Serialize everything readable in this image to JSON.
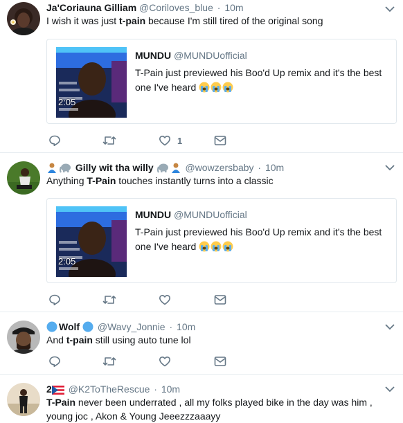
{
  "tweets": [
    {
      "name": "Ja'Coriauna Gilliam",
      "handle": "@Coriloves_blue",
      "separator": "·",
      "time": "10m",
      "text_before": "I wish it was just ",
      "text_bold": "t-pain",
      "text_after": " because I'm still tired of the original song",
      "quote": {
        "name": "MUNDU",
        "handle": "@MUNDUofficial",
        "text": "T-Pain just previewed his Boo'd Up remix and it's the best one I've heard",
        "video_time": "2:05"
      },
      "like_count": "1"
    },
    {
      "name": "Gilly wit tha willy",
      "handle": "@wowzersbaby",
      "separator": "·",
      "time": "10m",
      "text_before": "Anything ",
      "text_bold": "T-Pain",
      "text_after": " touches instantly turns into a classic",
      "quote": {
        "name": "MUNDU",
        "handle": "@MUNDUofficial",
        "text": "T-Pain just previewed his Boo'd Up remix and it's the best one I've heard",
        "video_time": "2:05"
      }
    },
    {
      "name": "Wolf",
      "handle": "@Wavy_Jonnie",
      "separator": "·",
      "time": "10m",
      "text_before": "And ",
      "text_bold": "t-pain",
      "text_after": " still using auto tune lol"
    },
    {
      "name": "2",
      "handle": "@K2ToTheRescue",
      "separator": "·",
      "time": "10m",
      "text_bold": "T-Pain",
      "text_after": " never been underrated , all my folks played bike in the day was him , young joc , Akon & Young Jeeezzzaaayy"
    }
  ],
  "icons": {
    "reply": "reply-icon",
    "retweet": "retweet-icon",
    "like": "heart-icon",
    "dm": "envelope-icon",
    "caret": "chevron-down-icon",
    "emoji_crying": "loudly-crying-face-emoji"
  },
  "colors": {
    "icon": "#657786",
    "divider": "#e6ecf0",
    "twitter_blue": "#1da1f2"
  }
}
